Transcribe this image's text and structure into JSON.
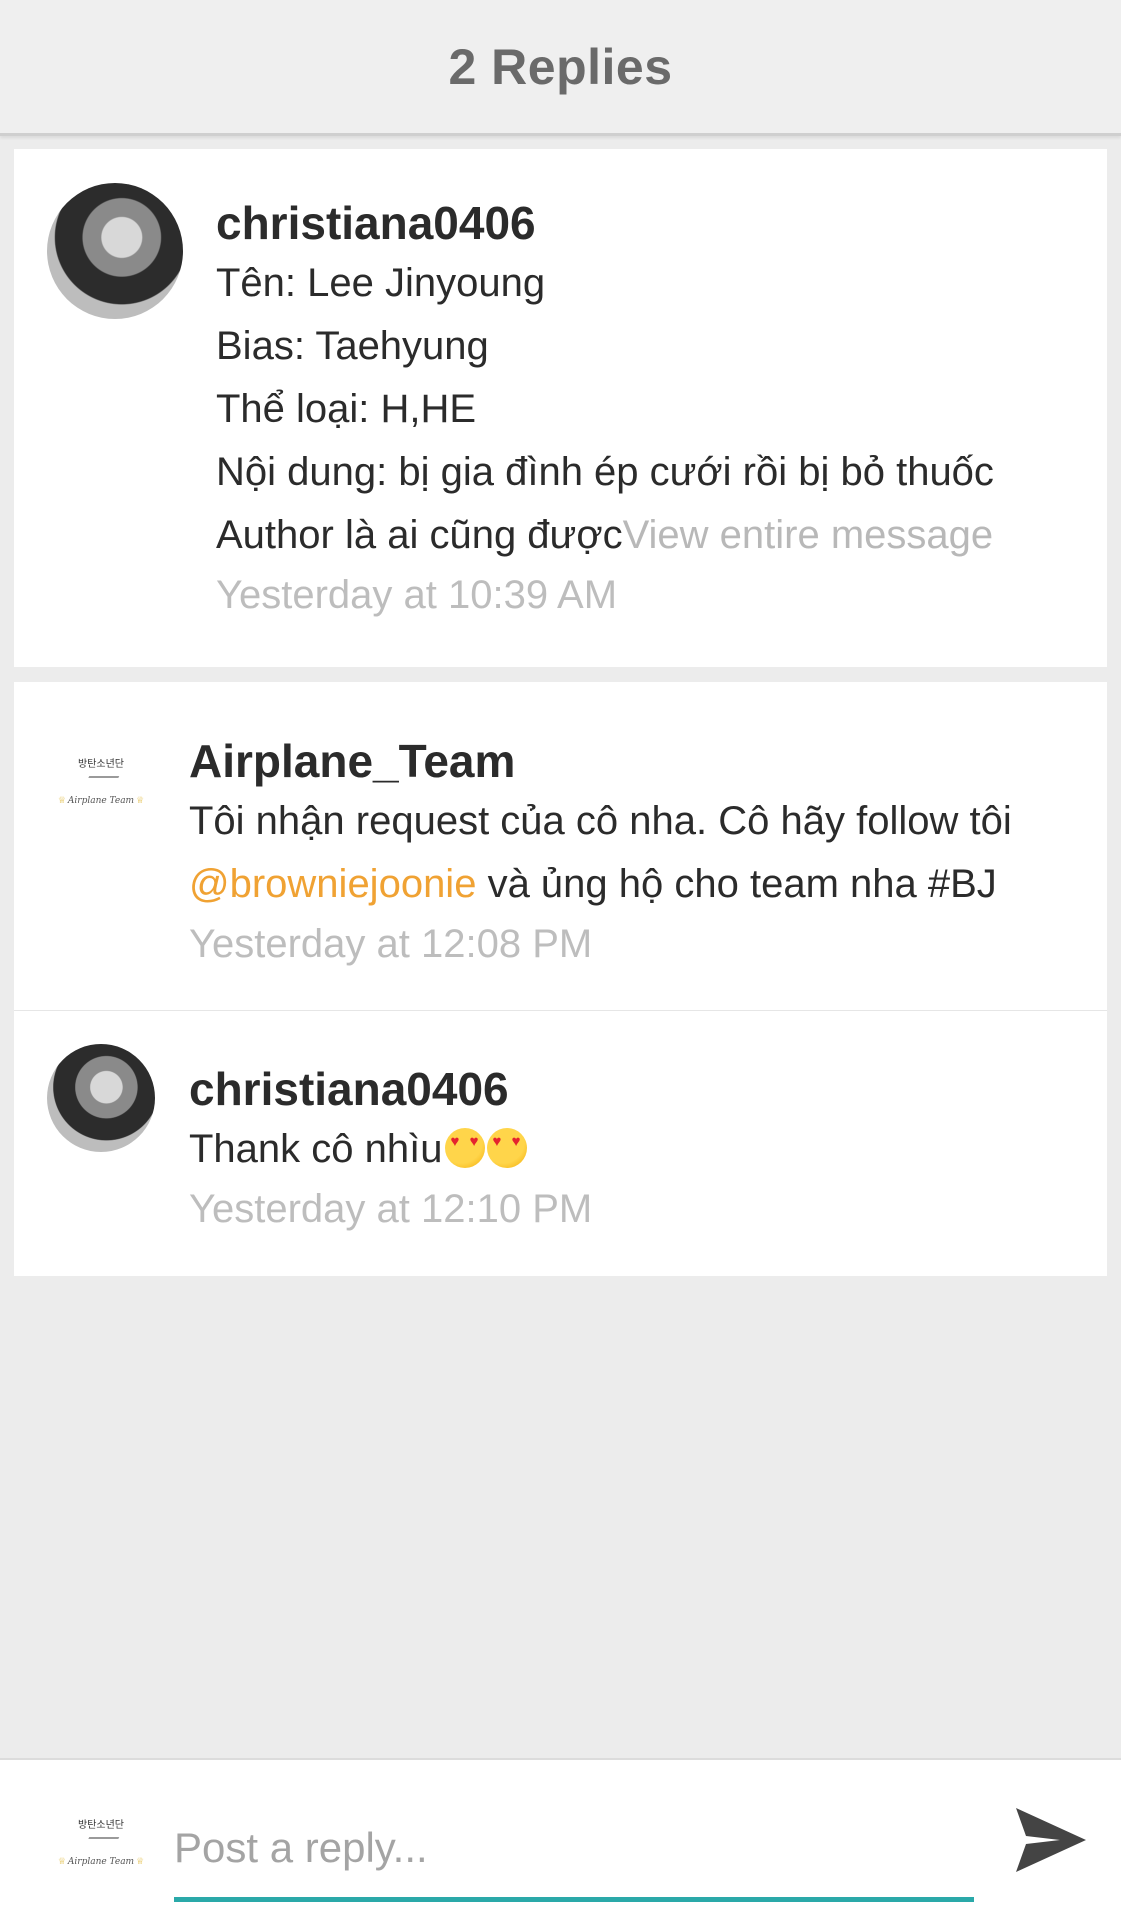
{
  "header": {
    "title": "2 Replies"
  },
  "original_post": {
    "username": "christiana0406",
    "lines": [
      "Tên: Lee Jinyoung",
      "Bias: Taehyung",
      "Thể loại: H,HE",
      "Nội dung: bị gia đình ép cưới rồi bị bỏ thuốc"
    ],
    "last_line_text": "Author là ai cũng được",
    "view_entire_label": "View entire message",
    "timestamp": "Yesterday at 10:39 AM",
    "avatar_icon": "user-photo-avatar"
  },
  "replies": [
    {
      "username": "Airplane_Team",
      "line1": "Tôi nhận request của cô nha. Cô hãy follow tôi",
      "mention": "@browniejoonie",
      "line2_rest": " và ủng hộ cho team nha #BJ",
      "timestamp": "Yesterday at 12:08 PM",
      "avatar": {
        "korean": "방탄소년단",
        "script": "Airplane Team"
      }
    },
    {
      "username": "christiana0406",
      "text": "Thank cô nhìu",
      "emoji": "heart-eyes-emoji",
      "timestamp": "Yesterday at 12:10 PM"
    }
  ],
  "reply_bar": {
    "placeholder": "Post a reply...",
    "avatar": {
      "korean": "방탄소년단",
      "script": "Airplane Team"
    },
    "send_icon": "send-icon"
  },
  "colors": {
    "accent_underline": "#2aa9a9",
    "mention": "#f0a233",
    "background": "#ececec"
  }
}
